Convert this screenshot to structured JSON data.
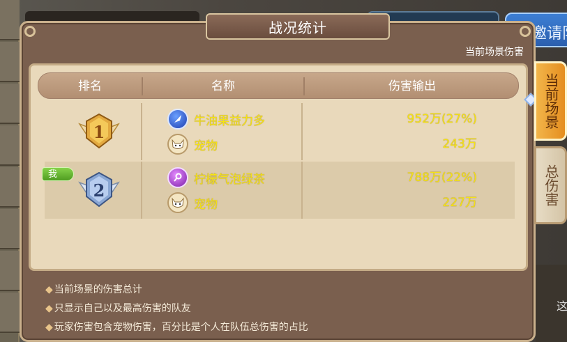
{
  "background": {
    "invite_button_label": "邀请队",
    "scene_right_text": "这"
  },
  "panel": {
    "title": "战况统计",
    "subtitle": "当前场景伤害",
    "table": {
      "headers": [
        "排名",
        "名称",
        "伤害输出"
      ],
      "rows": [
        {
          "rank": 1,
          "is_me": false,
          "player_name": "牛油果益力多",
          "player_damage": "952万(27%)",
          "pet_label": "宠物",
          "pet_damage": "243万"
        },
        {
          "rank": 2,
          "is_me": true,
          "me_label": "我",
          "player_name": "柠檬气泡绿茶",
          "player_damage": "788万(22%)",
          "pet_label": "宠物",
          "pet_damage": "227万"
        }
      ]
    },
    "notes": [
      "当前场景的伤害总计",
      "只显示自己以及最高伤害的队友",
      "玩家伤害包含宠物伤害，百分比是个人在队伍总伤害的占比"
    ]
  },
  "side_tabs": [
    {
      "label": "当前场景",
      "active": true
    },
    {
      "label": "总伤害",
      "active": false
    }
  ],
  "colors": {
    "panel_bg": "#7a5f4e",
    "table_bg": "#e9d9bb",
    "value_yellow": "#f5e316",
    "active_tab": "#f2b54a"
  }
}
